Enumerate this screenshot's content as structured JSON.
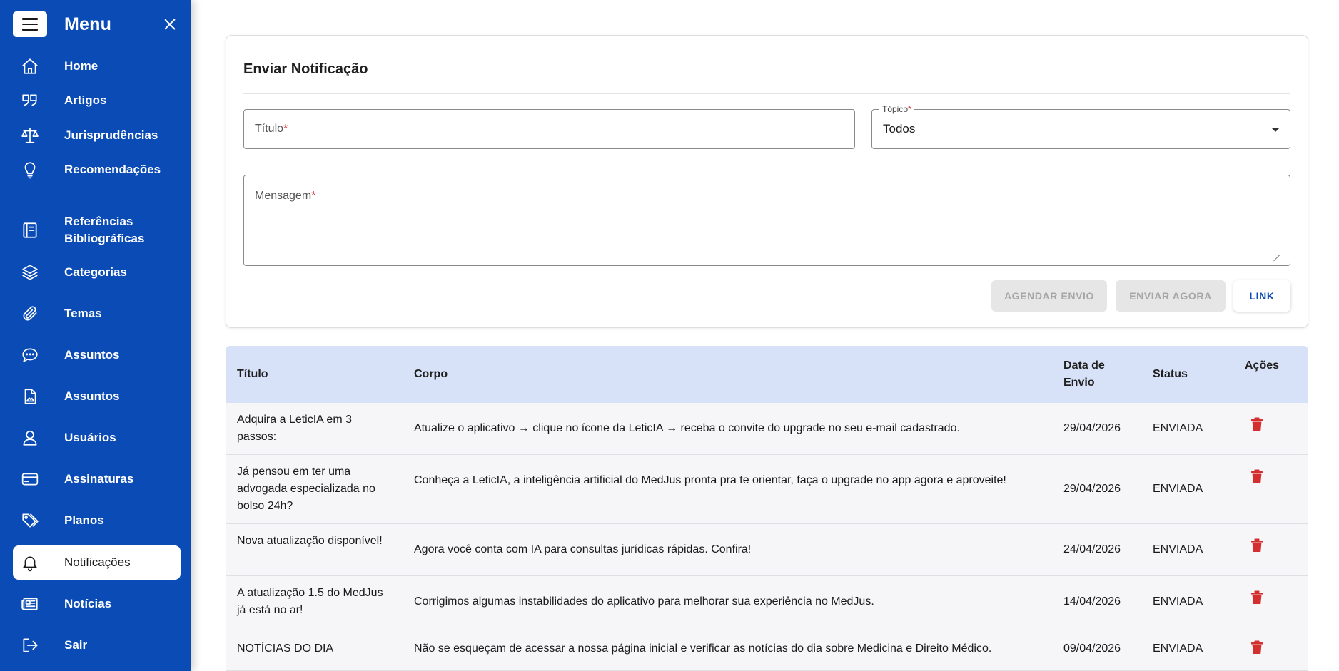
{
  "sidebar": {
    "title": "Menu",
    "items": [
      {
        "label": "Home",
        "icon": "home-icon"
      },
      {
        "label": "Artigos",
        "icon": "quote-icon"
      },
      {
        "label": "Jurisprudências",
        "icon": "scale-icon"
      },
      {
        "label": "Recomendações",
        "icon": "lightbulb-icon"
      },
      {
        "label": "Referências Bibliográficas",
        "icon": "book-icon"
      },
      {
        "label": "Categorias",
        "icon": "layers-icon"
      },
      {
        "label": "Temas",
        "icon": "paperclip-icon"
      },
      {
        "label": "Assuntos",
        "icon": "chat-bubble-icon"
      },
      {
        "label": "Assuntos",
        "icon": "document-image-icon"
      },
      {
        "label": "Usuários",
        "icon": "user-icon"
      },
      {
        "label": "Assinaturas",
        "icon": "credit-card-icon"
      },
      {
        "label": "Planos",
        "icon": "tags-icon"
      },
      {
        "label": "Notificações",
        "icon": "bell-icon",
        "active": true
      },
      {
        "label": "Notícias",
        "icon": "newspaper-icon"
      },
      {
        "label": "Sair",
        "icon": "logout-icon"
      }
    ]
  },
  "form": {
    "title": "Enviar Notificação",
    "titulo_placeholder": "Título",
    "topico_label": "Tópico",
    "topico_value": "Todos",
    "mensagem_placeholder": "Mensagem",
    "required_mark": "*",
    "buttons": {
      "agendar": "AGENDAR ENVIO",
      "enviar": "ENVIAR AGORA",
      "link": "LINK"
    }
  },
  "table": {
    "headers": {
      "titulo": "Título",
      "corpo": "Corpo",
      "data": "Data de Envio",
      "status": "Status",
      "acoes": "Ações"
    },
    "rows": [
      {
        "titulo": "Adquira a LeticIA em 3 passos:",
        "corpo": "Atualize o aplicativo → clique no ícone da LeticIA → receba o convite do upgrade no seu e-mail cadastrado.",
        "data": "29/04/2026",
        "status": "ENVIADA"
      },
      {
        "titulo": "Já pensou em ter uma advogada especializada no bolso 24h?",
        "corpo": "Conheça a LeticIA, a inteligência artificial do MedJus pronta pra te orientar, faça o upgrade no app agora e aproveite!",
        "data": "29/04/2026",
        "status": "ENVIADA"
      },
      {
        "titulo": "Nova atualização disponível!",
        "corpo": "Agora você conta com IA para consultas jurídicas rápidas. Confira!",
        "data": "24/04/2026",
        "status": "ENVIADA"
      },
      {
        "titulo": "A atualização 1.5 do MedJus já está no ar!",
        "corpo": "Corrigimos algumas instabilidades do aplicativo para melhorar sua experiência no MedJus.",
        "data": "14/04/2026",
        "status": "ENVIADA"
      },
      {
        "titulo": "NOTÍCIAS DO DIA",
        "corpo": "Não se esqueçam de acessar a nossa página inicial e verificar as notícias do dia sobre Medicina e Direito Médico.",
        "data": "09/04/2026",
        "status": "ENVIADA"
      }
    ]
  },
  "colors": {
    "sidebar_bg": "#0a4bb5",
    "table_header_bg": "#d7e1f7",
    "delete_icon": "#d32f2f",
    "required": "#d32f2f"
  }
}
